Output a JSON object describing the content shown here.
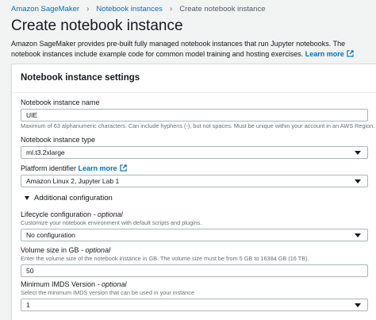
{
  "breadcrumb": {
    "items": [
      "Amazon SageMaker",
      "Notebook instances"
    ],
    "current": "Create notebook instance"
  },
  "page": {
    "title": "Create notebook instance",
    "description": "Amazon SageMaker provides pre-built fully managed notebook instances that run Jupyter notebooks. The notebook instances include example code for common model training and hosting exercises.",
    "learn_more": "Learn more"
  },
  "settings": {
    "header": "Notebook instance settings",
    "name": {
      "label": "Notebook instance name",
      "value": "UIE",
      "hint": "Maximum of 63 alphanumeric characters. Can include hyphens (-), but not spaces. Must be unique within your account in an AWS Region."
    },
    "type": {
      "label": "Notebook instance type",
      "value": "ml.t3.2xlarge"
    },
    "platform": {
      "label": "Platform identifier",
      "learn_more": "Learn more",
      "value": "Amazon Linux 2, Jupyter Lab 1"
    },
    "additional": {
      "label": "Additional configuration"
    },
    "lifecycle": {
      "label": "Lifecycle configuration",
      "optional": " - optional",
      "hint": "Customize your notebook environment with default scripts and plugins.",
      "value": "No configuration"
    },
    "volume": {
      "label": "Volume size in GB",
      "optional": " - optional",
      "hint": "Enter the volume size of the notebook instance in GB. The volume size must be from 5 GB to 16384 GB (16 TB).",
      "value": "50"
    },
    "imds": {
      "label": "Minimum IMDS Version",
      "optional": " - optional",
      "hint": "Select the minimum IMDS version that can be used in your instance",
      "value": "1"
    }
  },
  "icons": {
    "breadcrumb_separator": "chevron-right-icon",
    "external_link": "external-link-icon",
    "select_caret": "caret-down-icon",
    "expand": "triangle-down-icon"
  },
  "colors": {
    "link": "#0073bb",
    "background": "#f2f3f3",
    "panel": "#ffffff"
  }
}
